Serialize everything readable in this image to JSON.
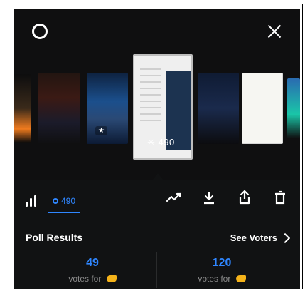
{
  "header": {
    "settings_icon": "settings-icon",
    "close_icon": "close-icon"
  },
  "thumbnail_center": {
    "views": "490"
  },
  "tabs": {
    "insights_icon": "bar-chart-icon",
    "votes_label": "490"
  },
  "actions": {
    "trend": "trend-icon",
    "download": "download-icon",
    "share": "share-icon",
    "delete": "trash-icon"
  },
  "poll": {
    "title": "Poll Results",
    "see_voters": "See Voters",
    "option_left": {
      "count": "49",
      "label": "votes for"
    },
    "option_right": {
      "count": "120",
      "label": "votes for"
    }
  },
  "colors": {
    "accent": "#2f86ff",
    "bg": "#0f0f10",
    "panel": "#111213",
    "muted": "#8a8a8a"
  }
}
